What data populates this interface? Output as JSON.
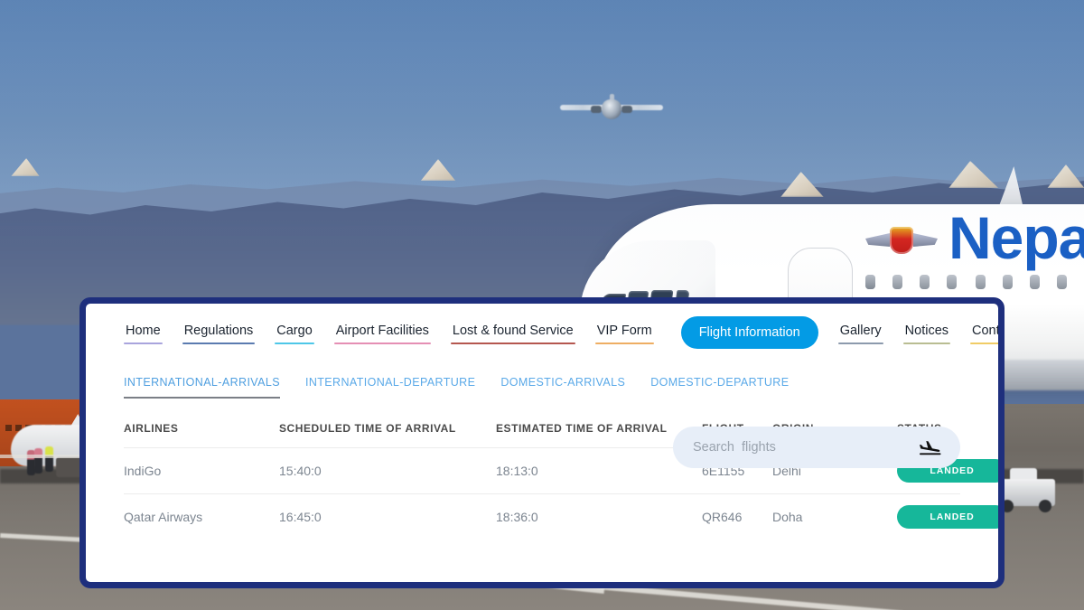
{
  "background": {
    "scene_description": "Airport tarmac with Nepal Airlines widebody jet, hazy blue Himalayan ridges and a small plane in flight",
    "aircraft_livery_text": "Nepa",
    "sky_color": "#6389b8",
    "ridge_color": "#53648a",
    "tarmac_color": "#7b756e"
  },
  "card": {
    "border_color": "#1e2f7d",
    "background_color": "#ffffff"
  },
  "nav": {
    "items": [
      {
        "label": "Home",
        "underline": "#a9a4dd",
        "active": false
      },
      {
        "label": "Regulations",
        "underline": "#5b7bb0",
        "active": false
      },
      {
        "label": "Cargo",
        "underline": "#4ec7e8",
        "active": false
      },
      {
        "label": "Airport Facilities",
        "underline": "#e58fb4",
        "active": false
      },
      {
        "label": "Lost & found Service",
        "underline": "#b5574f",
        "active": false
      },
      {
        "label": "VIP Form",
        "underline": "#eeae63",
        "active": false
      },
      {
        "label": "Flight Information",
        "underline": "#039be5",
        "active": true
      },
      {
        "label": "Gallery",
        "underline": "#8c9aad",
        "active": false
      },
      {
        "label": "Notices",
        "underline": "#b9bd92",
        "active": false
      },
      {
        "label": "Contact",
        "underline": "#f0cc66",
        "active": false
      }
    ],
    "active_pill_color": "#039be5",
    "active_pill_text_color": "#ffffff"
  },
  "tabs": {
    "items": [
      {
        "label": "INTERNATIONAL-ARRIVALS",
        "active": true
      },
      {
        "label": "INTERNATIONAL-DEPARTURE",
        "active": false
      },
      {
        "label": "DOMESTIC-ARRIVALS",
        "active": false
      },
      {
        "label": "DOMESTIC-DEPARTURE",
        "active": false
      }
    ],
    "color": "#5aa9e8",
    "active_underline_color": "#7b7f86"
  },
  "search": {
    "placeholder": "Search  flights",
    "value": "",
    "icon": "plane-landing-icon",
    "background_color": "#e7eef8"
  },
  "table": {
    "columns": [
      "AIRLINES",
      "SCHEDULED TIME OF ARRIVAL",
      "ESTIMATED TIME OF ARRIVAL",
      "FLIGHT",
      "ORIGIN",
      "STATUS"
    ],
    "rows": [
      {
        "airline": "IndiGo",
        "scheduled": "15:40:0",
        "estimated": "18:13:0",
        "flight": "6E1155",
        "origin": "Delhi",
        "status": "LANDED",
        "status_color": "#16b79a"
      },
      {
        "airline": "Qatar Airways",
        "scheduled": "16:45:0",
        "estimated": "18:36:0",
        "flight": "QR646",
        "origin": "Doha",
        "status": "LANDED",
        "status_color": "#16b79a"
      }
    ]
  }
}
